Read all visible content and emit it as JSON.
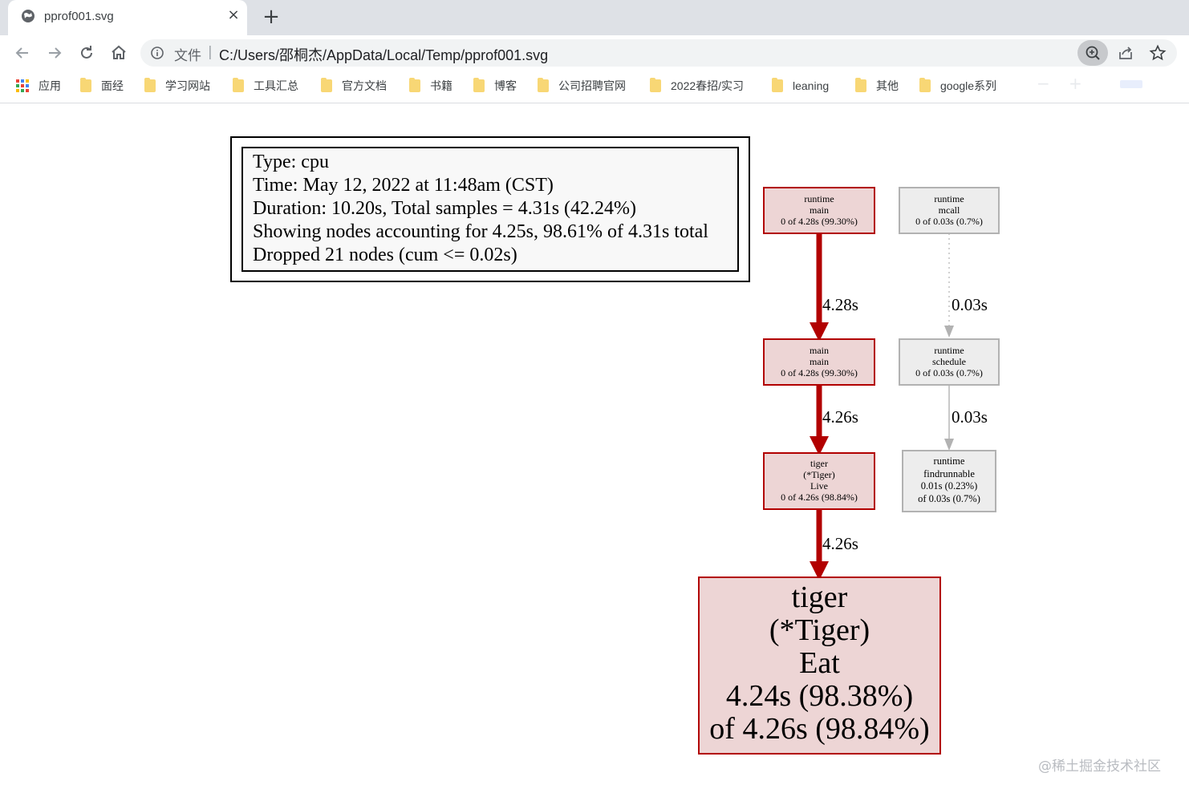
{
  "tab": {
    "title": "pprof001.svg",
    "close": "×",
    "new_tab": "+"
  },
  "omnibox": {
    "label": "文件",
    "separator": "|",
    "url": "C:/Users/邵桐杰/AppData/Local/Temp/pprof001.svg"
  },
  "bookmarks": [
    {
      "label": "应用",
      "icon": "apps-grid-icon"
    },
    {
      "label": "面经"
    },
    {
      "label": "学习网站"
    },
    {
      "label": "工具汇总"
    },
    {
      "label": "官方文档"
    },
    {
      "label": "书籍"
    },
    {
      "label": "博客"
    },
    {
      "label": "公司招聘官网"
    },
    {
      "label": "2022春招/实习"
    },
    {
      "label": "leaning"
    },
    {
      "label": "其他"
    },
    {
      "label": "google系列"
    }
  ],
  "legend": [
    "Type: cpu",
    "Time: May 12, 2022 at 11:48am (CST)",
    "Duration: 10.20s, Total samples = 4.31s (42.24%)",
    "Showing nodes accounting for 4.25s, 98.61% of 4.31s total",
    "Dropped 21 nodes (cum <= 0.02s)"
  ],
  "nodes": {
    "runtime_main": [
      "runtime",
      "main",
      "0 of 4.28s (99.30%)"
    ],
    "main_main": [
      "main",
      "main",
      "0 of 4.28s (99.30%)"
    ],
    "tiger_live": [
      "tiger",
      "(*Tiger)",
      "Live",
      "0 of 4.26s (98.84%)"
    ],
    "tiger_eat": [
      "tiger",
      "(*Tiger)",
      "Eat",
      "4.24s (98.38%)",
      "of 4.26s (98.84%)"
    ],
    "runtime_mcall": [
      "runtime",
      "mcall",
      "0 of 0.03s (0.7%)"
    ],
    "runtime_schedule": [
      "runtime",
      "schedule",
      "0 of 0.03s (0.7%)"
    ],
    "runtime_findrunnable": [
      "runtime",
      "findrunnable",
      "0.01s (0.23%)",
      "of 0.03s (0.7%)"
    ]
  },
  "edges": {
    "e1": "4.28s",
    "e2": "4.26s",
    "e3": "4.26s",
    "e4": "0.03s",
    "e5": "0.03s"
  },
  "colors": {
    "hot_edge": "#b20000",
    "hot_fill": "#edd5d5",
    "cold_edge": "#b2b2b2",
    "cold_fill": "#ededed"
  },
  "watermark": "@稀土掘金技术社区"
}
